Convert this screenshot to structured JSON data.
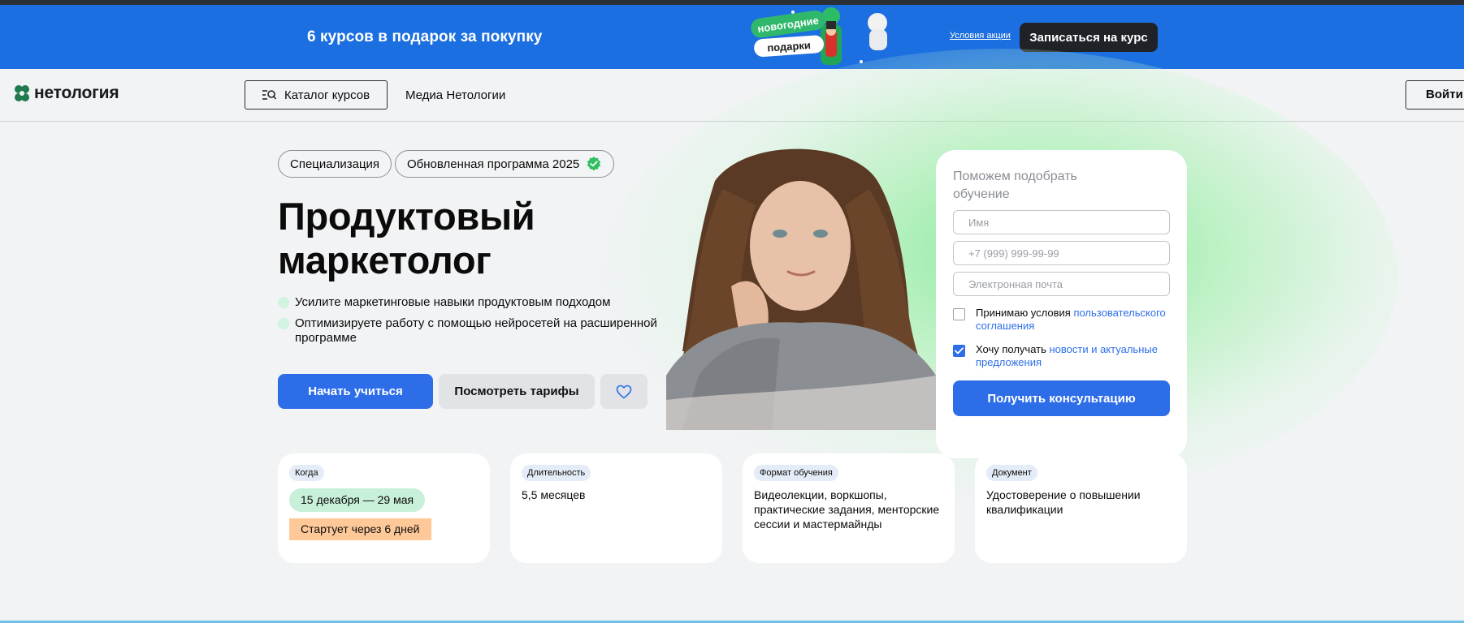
{
  "promo": {
    "text": "6 курсов в подарок за покупку",
    "art_top": "новогодние",
    "art_bottom": "подарки",
    "terms_link": "Условия акции",
    "cta": "Записаться на курс"
  },
  "header": {
    "logo": "нетология",
    "catalog": "Каталог курсов",
    "media": "Медиа Нетологии",
    "login": "Войти"
  },
  "hero": {
    "chips": [
      "Специализация",
      "Обновленная программа 2025"
    ],
    "title_line1": "Продуктовый",
    "title_line2": "маркетолог",
    "bullets": [
      "Усилите маркетинговые навыки продуктовым подходом",
      "Оптимизируете работу с помощью нейросетей на расширенной программе"
    ],
    "start_button": "Начать учиться",
    "tariffs_button": "Посмотреть тарифы"
  },
  "form": {
    "title": "Поможем подобрать обучение",
    "name_placeholder": "Имя",
    "phone_placeholder": "+7 (999) 999-99-99",
    "email_placeholder": "Электронная почта",
    "consent1_text": "Принимаю условия ",
    "consent1_link": "пользовательского соглашения",
    "consent1_checked": false,
    "consent2_text": "Хочу получать ",
    "consent2_link": "новости и актуальные предложения",
    "consent2_checked": true,
    "submit": "Получить консультацию"
  },
  "cards": [
    {
      "tag": "Когда",
      "date": "15 декабря — 29 мая",
      "badge": "Стартует через 6 дней"
    },
    {
      "tag": "Длительность",
      "text": "5,5 месяцев"
    },
    {
      "tag": "Формат обучения",
      "text": "Видеолекции, воркшопы, практические задания, менторские сессии и мастермайнды"
    },
    {
      "tag": "Документ",
      "text": "Удостоверение о повышении квалификации"
    }
  ],
  "colors": {
    "promo_bg": "#1c6fe0",
    "accent": "#2d6ee8",
    "glow": "#76e88c",
    "date_pill": "#c8f0d9",
    "start_badge": "#ffc898"
  }
}
